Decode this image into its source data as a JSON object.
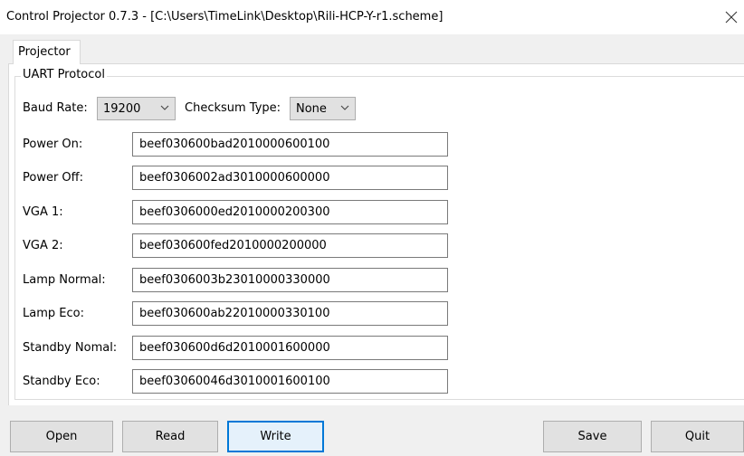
{
  "window": {
    "title": "Control Projector 0.7.3 - [C:\\Users\\TimeLink\\Desktop\\Rili-HCP-Y-r1.scheme]"
  },
  "tabs": [
    {
      "label": "Projector",
      "selected": true
    }
  ],
  "uart": {
    "group_label": "UART Protocol",
    "baud_rate_label": "Baud Rate:",
    "baud_rate_value": "19200",
    "checksum_label": "Checksum Type:",
    "checksum_value": "None"
  },
  "commands": [
    {
      "label": "Power On:",
      "value": "beef030600bad2010000600100"
    },
    {
      "label": "Power Off:",
      "value": "beef0306002ad3010000600000"
    },
    {
      "label": "VGA 1:",
      "value": "beef0306000ed2010000200300"
    },
    {
      "label": "VGA 2:",
      "value": "beef030600fed2010000200000"
    },
    {
      "label": "Lamp Normal:",
      "value": "beef0306003b23010000330000"
    },
    {
      "label": "Lamp Eco:",
      "value": "beef030600ab22010000330100"
    },
    {
      "label": "Standby Nomal:",
      "value": "beef030600d6d2010001600000"
    },
    {
      "label": "Standby Eco:",
      "value": "beef03060046d3010001600100"
    }
  ],
  "buttons": {
    "open": "Open",
    "read": "Read",
    "write": "Write",
    "save": "Save",
    "quit": "Quit"
  },
  "icons": {
    "close": "close-icon",
    "dropdown": "chevron-down-icon"
  },
  "colors": {
    "focus_border": "#0078d7",
    "button_face": "#e1e1e1",
    "window_body": "#f0f0f0"
  }
}
